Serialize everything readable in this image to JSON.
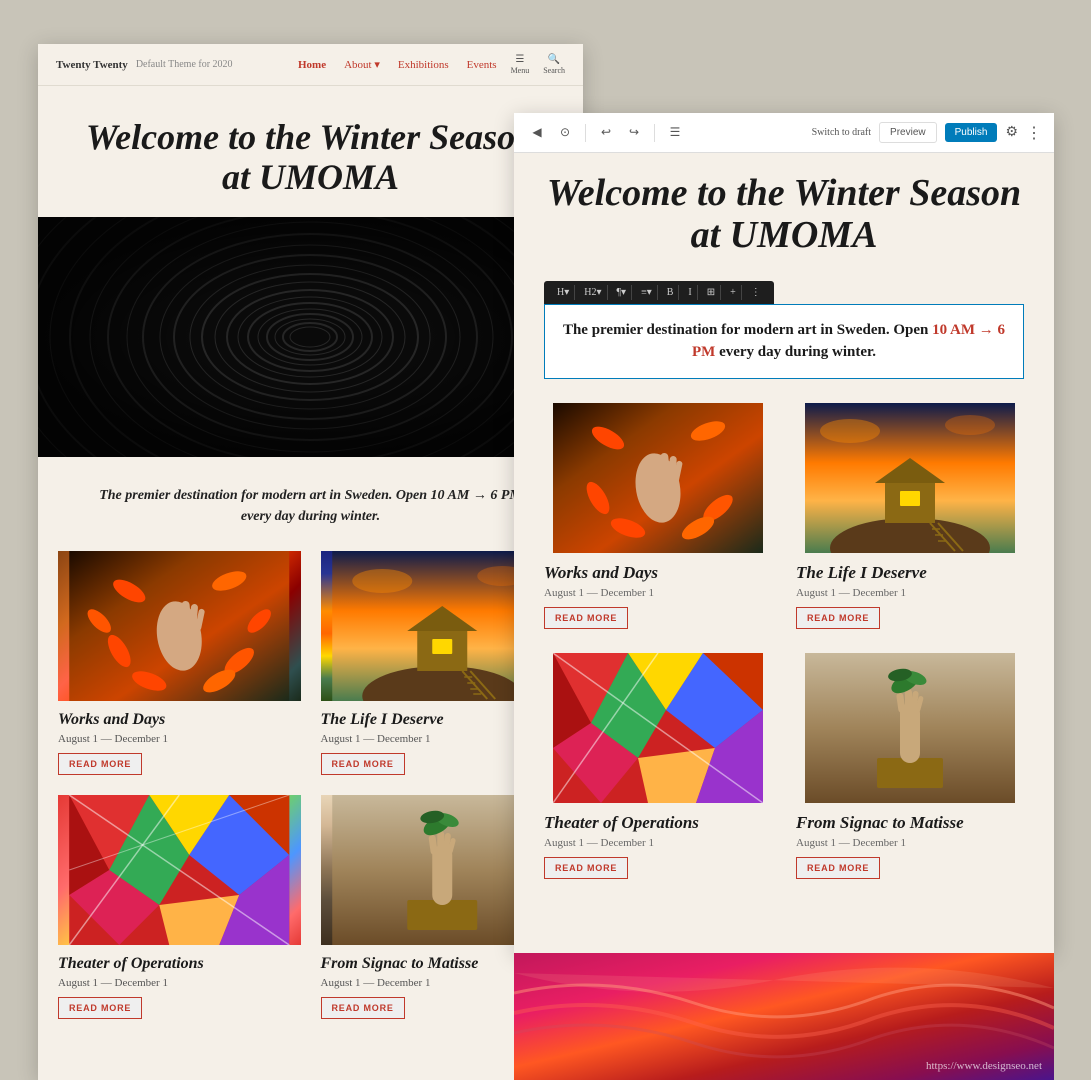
{
  "left_panel": {
    "nav": {
      "brand": "Twenty Twenty",
      "subtitle": "Default Theme for 2020",
      "links": [
        {
          "label": "Home",
          "active": true
        },
        {
          "label": "About",
          "has_dropdown": true
        },
        {
          "label": "Exhibitions",
          "active": false
        },
        {
          "label": "Events",
          "active": false
        }
      ],
      "menu_label": "Menu",
      "search_label": "Search"
    },
    "hero": {
      "title": "Welcome to the Winter Season at UMOMA",
      "subtitle": "The premier destination for modern art in Sweden. Open 10 AM → 6 PM every day during winter."
    },
    "exhibitions": [
      {
        "title": "Works and Days",
        "dates": "August 1 — December 1",
        "read_more": "READ MORE",
        "img_class": "img-hand-painting"
      },
      {
        "title": "The Life I Deserve",
        "dates": "August 1 — December 1",
        "read_more": "READ MORE",
        "img_class": "img-house-sky"
      },
      {
        "title": "Theater of Operations",
        "dates": "August 1 — December 1",
        "read_more": "READ MORE",
        "img_class": "img-colorful-quilt"
      },
      {
        "title": "From Signac to Matisse",
        "dates": "August 1 — December 1",
        "read_more": "READ MORE",
        "img_class": "img-hand-plant"
      }
    ]
  },
  "right_panel": {
    "toolbar": {
      "switch_draft": "Switch to draft",
      "preview": "Preview",
      "publish": "Publish"
    },
    "hero": {
      "title": "Welcome to the Winter Season at UMOMA"
    },
    "paragraph_block": {
      "text_before": "The premier destination for modern art in Sweden. Open ",
      "highlight": "10 AM → 6 PM",
      "text_after": " every day during winter."
    },
    "block_tools": [
      "H",
      "H2",
      "¶",
      "≡",
      "B",
      "I",
      "⊞",
      "+",
      "⋮"
    ],
    "exhibitions": [
      {
        "title": "Works and Days",
        "dates": "August 1 — December 1",
        "read_more": "READ MORE",
        "img_class": "img-hand-painting"
      },
      {
        "title": "The Life I Deserve",
        "dates": "August 1 — December 1",
        "read_more": "READ MORE",
        "img_class": "img-house-sky"
      },
      {
        "title": "Theater of Operations",
        "dates": "August 1 — December 1",
        "read_more": "READ MORE",
        "img_class": "img-colorful-quilt"
      },
      {
        "title": "From Signac to Matisse",
        "dates": "August 1 — December 1",
        "read_more": "READ MORE",
        "img_class": "img-hand-plant"
      }
    ]
  },
  "watermark": "https://www.designseo.net"
}
